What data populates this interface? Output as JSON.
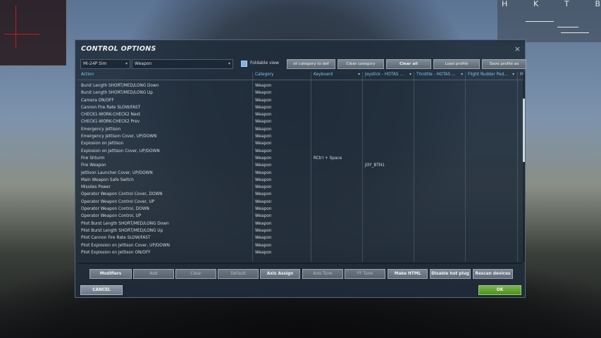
{
  "dialog": {
    "title": "CONTROL OPTIONS",
    "close": "×"
  },
  "toolbar": {
    "aircraft_select": "Mi-24P Sim",
    "category_select": "Weapon",
    "foldable_label": "Foldable view",
    "buttons": [
      "et category to def",
      "Clear category",
      "Clear all",
      "Load profile",
      "Save profile as"
    ]
  },
  "hud": {
    "letters": [
      "H",
      "K",
      "T",
      "B"
    ]
  },
  "table": {
    "headers": [
      "Action",
      "Category",
      "Keyboard",
      "Joystick - HOTAS ...",
      "Throttle - HOTAS ...",
      "Flight Rudder Ped...",
      "M"
    ],
    "rows": [
      {
        "action": "Burst Length SHORT/MED/LONG Down",
        "category": "Weapon",
        "keyboard": "",
        "joystick": ""
      },
      {
        "action": "Burst Length SHORT/MED/LONG Up",
        "category": "Weapon",
        "keyboard": "",
        "joystick": ""
      },
      {
        "action": "Camera ON/OFF",
        "category": "Weapon",
        "keyboard": "",
        "joystick": ""
      },
      {
        "action": "Cannon Fire Rate SLOW/FAST",
        "category": "Weapon",
        "keyboard": "",
        "joystick": ""
      },
      {
        "action": "CHECK1-WORK-CHECK2 Next",
        "category": "Weapon",
        "keyboard": "",
        "joystick": ""
      },
      {
        "action": "CHECK1-WORK-CHECK2 Prev",
        "category": "Weapon",
        "keyboard": "",
        "joystick": ""
      },
      {
        "action": "Emergency Jettison",
        "category": "Weapon",
        "keyboard": "",
        "joystick": ""
      },
      {
        "action": "Emergency Jettison Cover, UP/DOWN",
        "category": "Weapon",
        "keyboard": "",
        "joystick": ""
      },
      {
        "action": "Explosion on Jettison",
        "category": "Weapon",
        "keyboard": "",
        "joystick": ""
      },
      {
        "action": "Explosion on Jettison Cover, UP/DOWN",
        "category": "Weapon",
        "keyboard": "",
        "joystick": ""
      },
      {
        "action": "Fire Shturm",
        "category": "Weapon",
        "keyboard": "RCtrl + Space",
        "joystick": ""
      },
      {
        "action": "Fire Weapon",
        "category": "Weapon",
        "keyboard": "",
        "joystick": "JOY_BTN1"
      },
      {
        "action": "Jettison Launcher Cover, UP/DOWN",
        "category": "Weapon",
        "keyboard": "",
        "joystick": ""
      },
      {
        "action": "Main Weapon Safe Switch",
        "category": "Weapon",
        "keyboard": "",
        "joystick": ""
      },
      {
        "action": "Missiles Power",
        "category": "Weapon",
        "keyboard": "",
        "joystick": ""
      },
      {
        "action": "Operator Weapon Control Cover, DOWN",
        "category": "Weapon",
        "keyboard": "",
        "joystick": ""
      },
      {
        "action": "Operator Weapon Control Cover, UP",
        "category": "Weapon",
        "keyboard": "",
        "joystick": ""
      },
      {
        "action": "Operator Weapon Control, DOWN",
        "category": "Weapon",
        "keyboard": "",
        "joystick": ""
      },
      {
        "action": "Operator Weapon Control, UP",
        "category": "Weapon",
        "keyboard": "",
        "joystick": ""
      },
      {
        "action": "Pilot Burst Length SHORT/MED/LONG Down",
        "category": "Weapon",
        "keyboard": "",
        "joystick": ""
      },
      {
        "action": "Pilot Burst Length SHORT/MED/LONG Up",
        "category": "Weapon",
        "keyboard": "",
        "joystick": ""
      },
      {
        "action": "Pilot Cannon Fire Rate SLOW/FAST",
        "category": "Weapon",
        "keyboard": "",
        "joystick": ""
      },
      {
        "action": "Pilot Explosion on Jettison Cover, UP/DOWN",
        "category": "Weapon",
        "keyboard": "",
        "joystick": ""
      },
      {
        "action": "Pilot Explosion on Jettison ON/OFF",
        "category": "Weapon",
        "keyboard": "",
        "joystick": ""
      }
    ]
  },
  "bottom_buttons": {
    "modifiers": "Modifiers",
    "add": "Add",
    "clear": "Clear",
    "default": "Default",
    "axis_assign": "Axis Assign",
    "axis_tune": "Axis Tune",
    "ff_tune": "FF Tune",
    "make_html": "Make HTML",
    "disable_hot_plug": "Disable hot plug",
    "rescan_devices": "Rescan devices",
    "cancel": "CANCEL",
    "ok": "OK"
  },
  "colors": {
    "header_text": "#7fc6f2",
    "ok_button": "#5e9e30",
    "dialog_bg": "#202c3a"
  }
}
